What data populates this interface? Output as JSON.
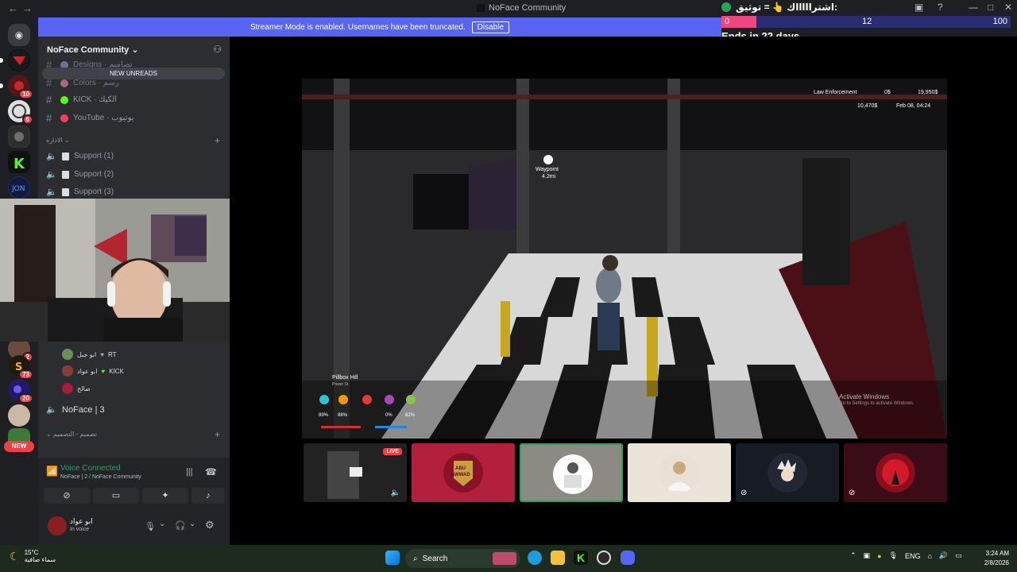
{
  "window": {
    "title": "NoFace Community"
  },
  "poll": {
    "question": "اشتراااااك 👆 = توثيق:",
    "bar_start": "0",
    "bar_mid": "12",
    "bar_end": "100",
    "progress": 0.12,
    "ends": "Ends in 22 days"
  },
  "banner": {
    "text": "Streamer Mode is enabled. Usernames have been truncated.",
    "disable_label": "Disable"
  },
  "server_rail": {
    "badges": [
      "10",
      "6",
      "2",
      "73",
      "20"
    ],
    "new_label": "NEW"
  },
  "sidebar": {
    "server_name": "NoFace Community",
    "new_unreads": "NEW UNREADS",
    "channels": [
      {
        "name": "Designs · تصاميم",
        "color": "#8a8fc9"
      },
      {
        "name": "Colors · رسم",
        "color": "#e07da2"
      },
      {
        "name": "KICK · الكيك",
        "color": "#53fc18"
      },
      {
        "name": "YouTube · يوتيوب",
        "color": "#ff3b5c"
      }
    ],
    "category_admin": "الاداره",
    "support": [
      "Support (1)",
      "Support (2)",
      "Support (3)"
    ],
    "voice_users": [
      {
        "name": "ابو جبل",
        "tag": "RT",
        "color": "#6a8f5a"
      },
      {
        "name": "ابو عواد",
        "tag": "KICK",
        "color": "#8a3b3b"
      },
      {
        "name": "صالح",
        "tag": "",
        "color": "#a0203b"
      }
    ],
    "voice_channel": "NoFace | 3",
    "category_design": "تصميم - التصميم"
  },
  "voice_panel": {
    "status": "Voice Connected",
    "channel": "NoFace | 2 / NoFace Community"
  },
  "user": {
    "name": "ابو عواد",
    "status": "In voice"
  },
  "hud": {
    "job": "Law Enforcement",
    "cash": "0$",
    "bank": "19,950$",
    "dirty": "10,470$",
    "date": "Feb 08, 04:24",
    "waypoint": "Waypoint",
    "waypoint_dist": "4.2mi",
    "location": "Pillbox Hill",
    "location_sub": "Power St",
    "stats": [
      "89%",
      "88%",
      "",
      "0%",
      "82%"
    ],
    "activate_title": "Activate Windows",
    "activate_sub": "Go to Settings to activate Windows."
  },
  "tiles": {
    "live_label": "LIVE",
    "abu_line1": "ABU",
    "abu_line2": "AWWAD"
  },
  "taskbar": {
    "temp": "15°C",
    "weather": "سماء صافية",
    "search": "Search",
    "lang": "ENG",
    "time": "3:24 AM",
    "date": "2/8/2026"
  }
}
